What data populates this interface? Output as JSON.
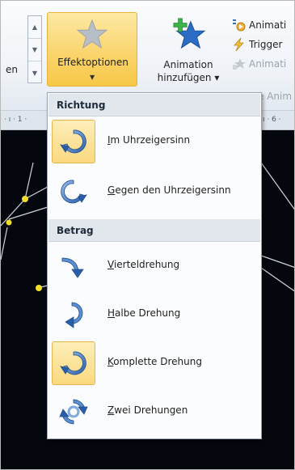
{
  "ribbon": {
    "left_combo_text": "en",
    "effekt_button_label": "Effektoptionen",
    "add_animation_line1": "Animation",
    "add_animation_line2": "hinzufügen",
    "right_items": [
      {
        "label": "Animati",
        "icon": "animation-pane-icon",
        "disabled": false
      },
      {
        "label": "Trigger",
        "icon": "lightning-trigger-icon",
        "disabled": false
      },
      {
        "label": "Animati",
        "icon": "animation-painter-icon",
        "disabled": true
      }
    ],
    "behind_menu_text": "e Anim"
  },
  "ruler": {
    "left_text": "· ı · 1 ·",
    "right_text": "ı · 6 ·"
  },
  "menu": {
    "sections": [
      {
        "header": "Richtung",
        "items": [
          {
            "accel": "I",
            "rest": "m Uhrzeigersinn",
            "icon": "clockwise-rotation-icon",
            "selected": true
          },
          {
            "accel": "G",
            "rest": "egen den Uhrzeigersinn",
            "icon": "counterclockwise-rotation-icon",
            "selected": false
          }
        ]
      },
      {
        "header": "Betrag",
        "items": [
          {
            "accel": "V",
            "rest": "ierteldrehung",
            "icon": "quarter-spin-icon",
            "selected": false
          },
          {
            "accel": "H",
            "rest": "albe Drehung",
            "icon": "half-spin-icon",
            "selected": false
          },
          {
            "accel": "K",
            "rest": "omplette Drehung",
            "icon": "full-spin-icon",
            "selected": true
          },
          {
            "accel": "Z",
            "rest": "wei Drehungen",
            "icon": "two-spins-icon",
            "selected": false
          }
        ]
      }
    ]
  },
  "colors": {
    "selected_gradient_top": "#fdeeb9",
    "selected_gradient_bottom": "#fbd97f",
    "arrow_blue_dark": "#2a5ea8",
    "arrow_blue_light": "#8db6e6",
    "canvas_bg": "#05070f"
  }
}
